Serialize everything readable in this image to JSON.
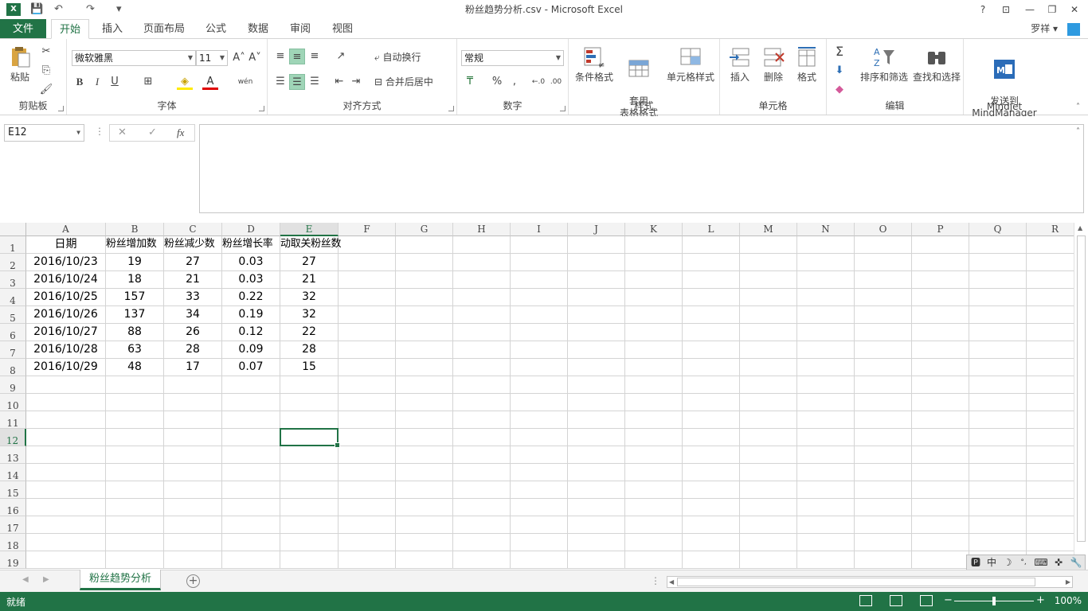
{
  "window": {
    "title": "粉丝趋势分析.csv - Microsoft Excel",
    "help": "?",
    "minimize": "—",
    "restore": "❐",
    "close": "✕",
    "ribbon_display": "⊡"
  },
  "qat": {
    "save": "💾",
    "undo": "↶",
    "redo": "↷",
    "customize": "▾"
  },
  "tabs": {
    "file": "文件",
    "items": [
      "开始",
      "插入",
      "页面布局",
      "公式",
      "数据",
      "审阅",
      "视图"
    ],
    "user": "罗祥 ▾"
  },
  "ribbon": {
    "clipboard": {
      "label": "剪贴板",
      "paste": "粘贴"
    },
    "font": {
      "label": "字体",
      "name": "微软雅黑",
      "size": "11",
      "grow": "A˄",
      "shrink": "A˅",
      "bold": "B",
      "italic": "I",
      "underline": "U",
      "border": "⊞",
      "fill": "◈",
      "color": "A",
      "phonetic": "wén"
    },
    "alignment": {
      "label": "对齐方式",
      "wrap": "自动换行",
      "merge": "合并后居中"
    },
    "number": {
      "label": "数字",
      "format": "常规",
      "percent": "%",
      "comma": ","
    },
    "styles": {
      "label": "样式",
      "cond": "条件格式",
      "table": "套用\n表格格式",
      "cell_styles": "单元格样式"
    },
    "cells": {
      "label": "单元格",
      "insert": "插入",
      "delete": "删除",
      "format": "格式"
    },
    "editing": {
      "label": "编辑",
      "sum": "Σ",
      "sort": "排序和筛选",
      "find": "查找和选择"
    },
    "mindjet": {
      "label": "Mindjet",
      "send": "发送到\nMindManager"
    }
  },
  "formula_bar": {
    "name_box": "E12",
    "cancel": "✕",
    "enter": "✓",
    "fx": "fx",
    "value": ""
  },
  "columns": [
    "A",
    "B",
    "C",
    "D",
    "E",
    "F",
    "G",
    "H",
    "I",
    "J",
    "K",
    "L",
    "M",
    "N",
    "O",
    "P",
    "Q",
    "R"
  ],
  "rows": [
    "1",
    "2",
    "3",
    "4",
    "5",
    "6",
    "7",
    "8",
    "9",
    "10",
    "11",
    "12",
    "13",
    "14",
    "15",
    "16",
    "17",
    "18",
    "19"
  ],
  "cells": [
    [
      "日期",
      "粉丝增加数",
      "粉丝减少数",
      "粉丝增长率",
      "动取关粉丝数"
    ],
    [
      "2016/10/23",
      "19",
      "27",
      "0.03",
      "27"
    ],
    [
      "2016/10/24",
      "18",
      "21",
      "0.03",
      "21"
    ],
    [
      "2016/10/25",
      "157",
      "33",
      "0.22",
      "32"
    ],
    [
      "2016/10/26",
      "137",
      "34",
      "0.19",
      "32"
    ],
    [
      "2016/10/27",
      "88",
      "26",
      "0.12",
      "22"
    ],
    [
      "2016/10/28",
      "63",
      "28",
      "0.09",
      "28"
    ],
    [
      "2016/10/29",
      "48",
      "17",
      "0.07",
      "15"
    ]
  ],
  "selected_cell": "E12",
  "sheet": {
    "tab": "粉丝趋势分析",
    "add": "+"
  },
  "status": {
    "ready": "就绪",
    "zoom": "100%",
    "minus": "−",
    "plus": "+"
  },
  "ime": {
    "items": [
      "🅿",
      "中",
      "☽",
      "°,",
      "⌨",
      "✜",
      "🔧"
    ]
  }
}
